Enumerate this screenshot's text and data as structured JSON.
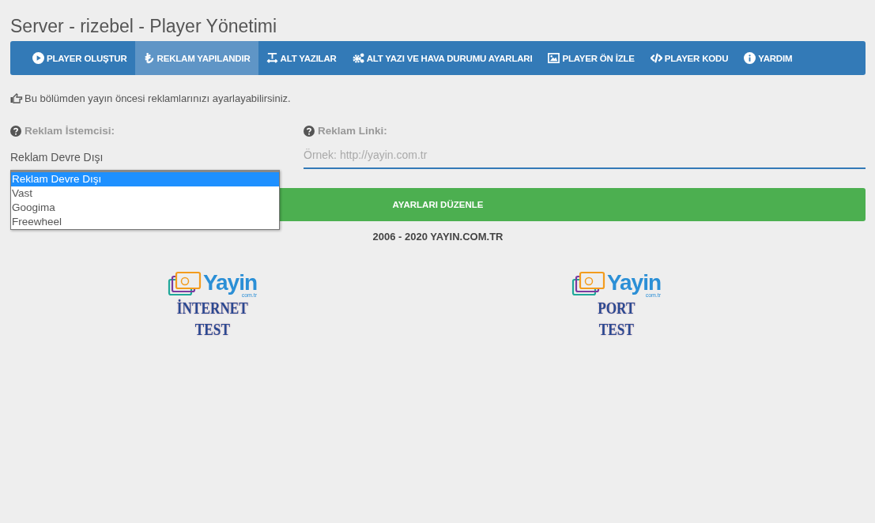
{
  "page_title": "Server - rizebel - Player Yönetimi",
  "tabs": [
    {
      "label": "PLAYER OLUŞTUR",
      "selected": false
    },
    {
      "label": "REKLAM YAPILANDIR",
      "selected": true
    },
    {
      "label": "ALT YAZILAR",
      "selected": false
    },
    {
      "label": "ALT YAZI VE HAVA DURUMU AYARLARI",
      "selected": false
    },
    {
      "label": "PLAYER ÖN İZLE",
      "selected": false
    },
    {
      "label": "PLAYER KODU",
      "selected": false
    },
    {
      "label": "YARDIM",
      "selected": false
    }
  ],
  "note": "Bu bölümden yayın öncesi reklamlarınızı ayarlayabilirsiniz.",
  "client": {
    "label": "Reklam İstemcisi:",
    "value": "Reklam Devre Dışı",
    "expanded": true,
    "options": [
      {
        "label": "Reklam Devre Dışı",
        "selected": true
      },
      {
        "label": "Vast",
        "selected": false
      },
      {
        "label": "Googima",
        "selected": false
      },
      {
        "label": "Freewheel",
        "selected": false
      }
    ]
  },
  "link": {
    "label": "Reklam Linki:",
    "placeholder": "Örnek: http://yayin.com.tr"
  },
  "save_button": "AYARLARI DÜZENLE",
  "footer": "2006 - 2020 YAYIN.COM.TR",
  "logos": [
    {
      "brand": "Yayin",
      "domain": "com.tr",
      "lines": [
        "İNTERNET",
        "TEST"
      ]
    },
    {
      "brand": "Yayin",
      "domain": "com.tr",
      "lines": [
        "PORT",
        "TEST"
      ]
    }
  ]
}
